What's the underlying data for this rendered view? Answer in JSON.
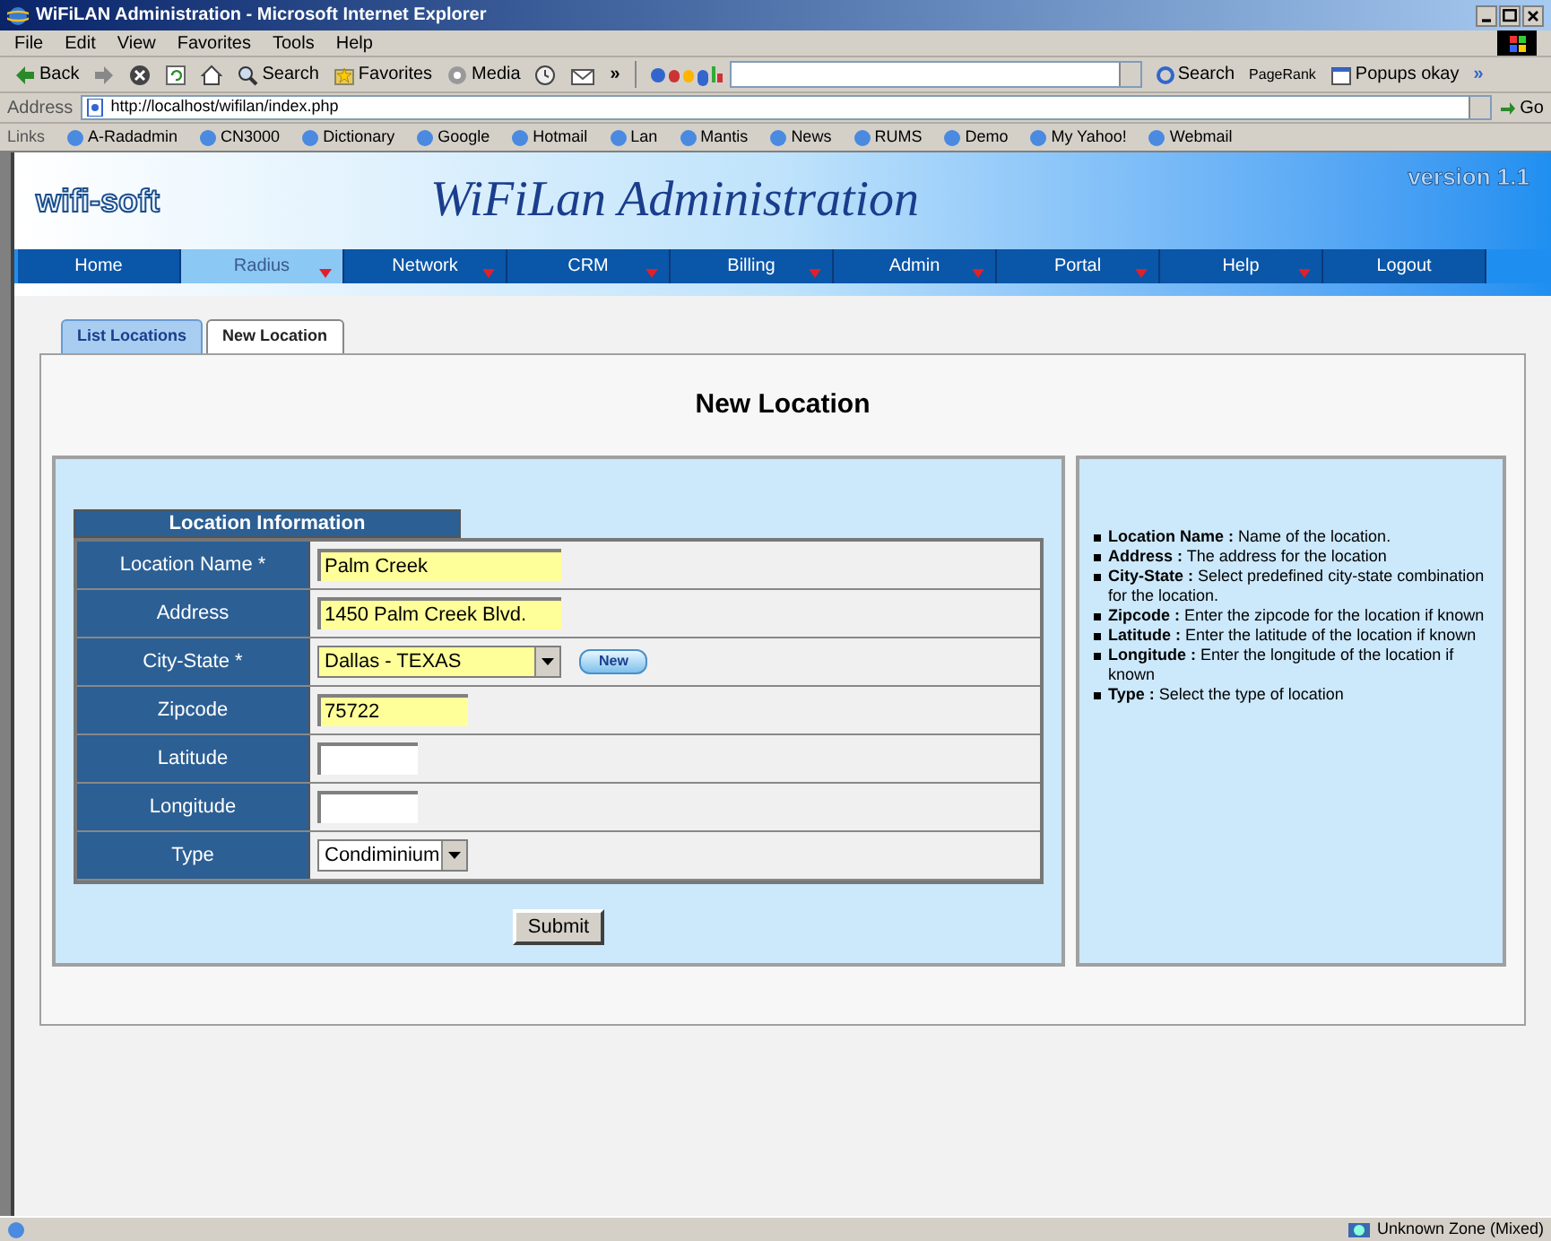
{
  "window": {
    "title": "WiFiLAN Administration - Microsoft Internet Explorer"
  },
  "menu_bar": [
    "File",
    "Edit",
    "View",
    "Favorites",
    "Tools",
    "Help"
  ],
  "toolbar": {
    "back": "Back",
    "search": "Search",
    "favorites": "Favorites",
    "media": "Media",
    "more": "»",
    "google_search": "Search",
    "pagerank": "PageRank",
    "popups": "Popups okay",
    "more_right": "»"
  },
  "address_bar": {
    "label": "Address",
    "url": "http://localhost/wifilan/index.php",
    "go": "Go"
  },
  "links_bar": {
    "label": "Links",
    "items": [
      "A-Radadmin",
      "CN3000",
      "Dictionary",
      "Google",
      "Hotmail",
      "Lan",
      "Mantis",
      "News",
      "RUMS",
      "Demo",
      "My Yahoo!",
      "Webmail"
    ]
  },
  "header": {
    "logo": "wifi-soft",
    "title": "WiFiLan Administration",
    "version": "version 1.1"
  },
  "nav": [
    {
      "label": "Home",
      "selected": false,
      "has_menu": false
    },
    {
      "label": "Radius",
      "selected": true,
      "has_menu": true
    },
    {
      "label": "Network",
      "selected": false,
      "has_menu": true
    },
    {
      "label": "CRM",
      "selected": false,
      "has_menu": true
    },
    {
      "label": "Billing",
      "selected": false,
      "has_menu": true
    },
    {
      "label": "Admin",
      "selected": false,
      "has_menu": true
    },
    {
      "label": "Portal",
      "selected": false,
      "has_menu": true
    },
    {
      "label": "Help",
      "selected": false,
      "has_menu": true
    },
    {
      "label": "Logout",
      "selected": false,
      "has_menu": false
    }
  ],
  "tabs": [
    {
      "label": "List Locations",
      "selected": false
    },
    {
      "label": "New Location",
      "selected": true
    }
  ],
  "page_title": "New Location",
  "form": {
    "title": "Location Information",
    "fields": [
      {
        "label": "Location Name *",
        "kind": "text",
        "value": "Palm Creek",
        "highlighted": true
      },
      {
        "label": "Address",
        "kind": "text",
        "value": "1450 Palm Creek Blvd.",
        "highlighted": true
      },
      {
        "label": "City-State *",
        "kind": "select",
        "value": "Dallas - TEXAS",
        "highlighted": true,
        "button": "New"
      },
      {
        "label": "Zipcode",
        "kind": "code",
        "value": "75722",
        "highlighted": true
      },
      {
        "label": "Latitude",
        "kind": "number",
        "highlighted": false
      },
      {
        "label": "Longitude",
        "kind": "number",
        "highlighted": false
      },
      {
        "label": "Type",
        "kind": "choice",
        "value": "Condiminium",
        "highlighted": false
      }
    ],
    "submit": "Submit"
  },
  "help": [
    "**Location Name :** Name of the location.",
    "**Address :** The address for the location",
    "**City-State :** Select predefined city-state combination for the location.",
    "**Zipcode :** Enter the zipcode for the location if known",
    "**Latitude :** Enter the latitude of the location if known",
    "**Longitude :** Enter the longitude of the location if known",
    "**Type :** Select the type of location"
  ],
  "status_bar": {
    "zone": "Unknown Zone (Mixed)"
  }
}
